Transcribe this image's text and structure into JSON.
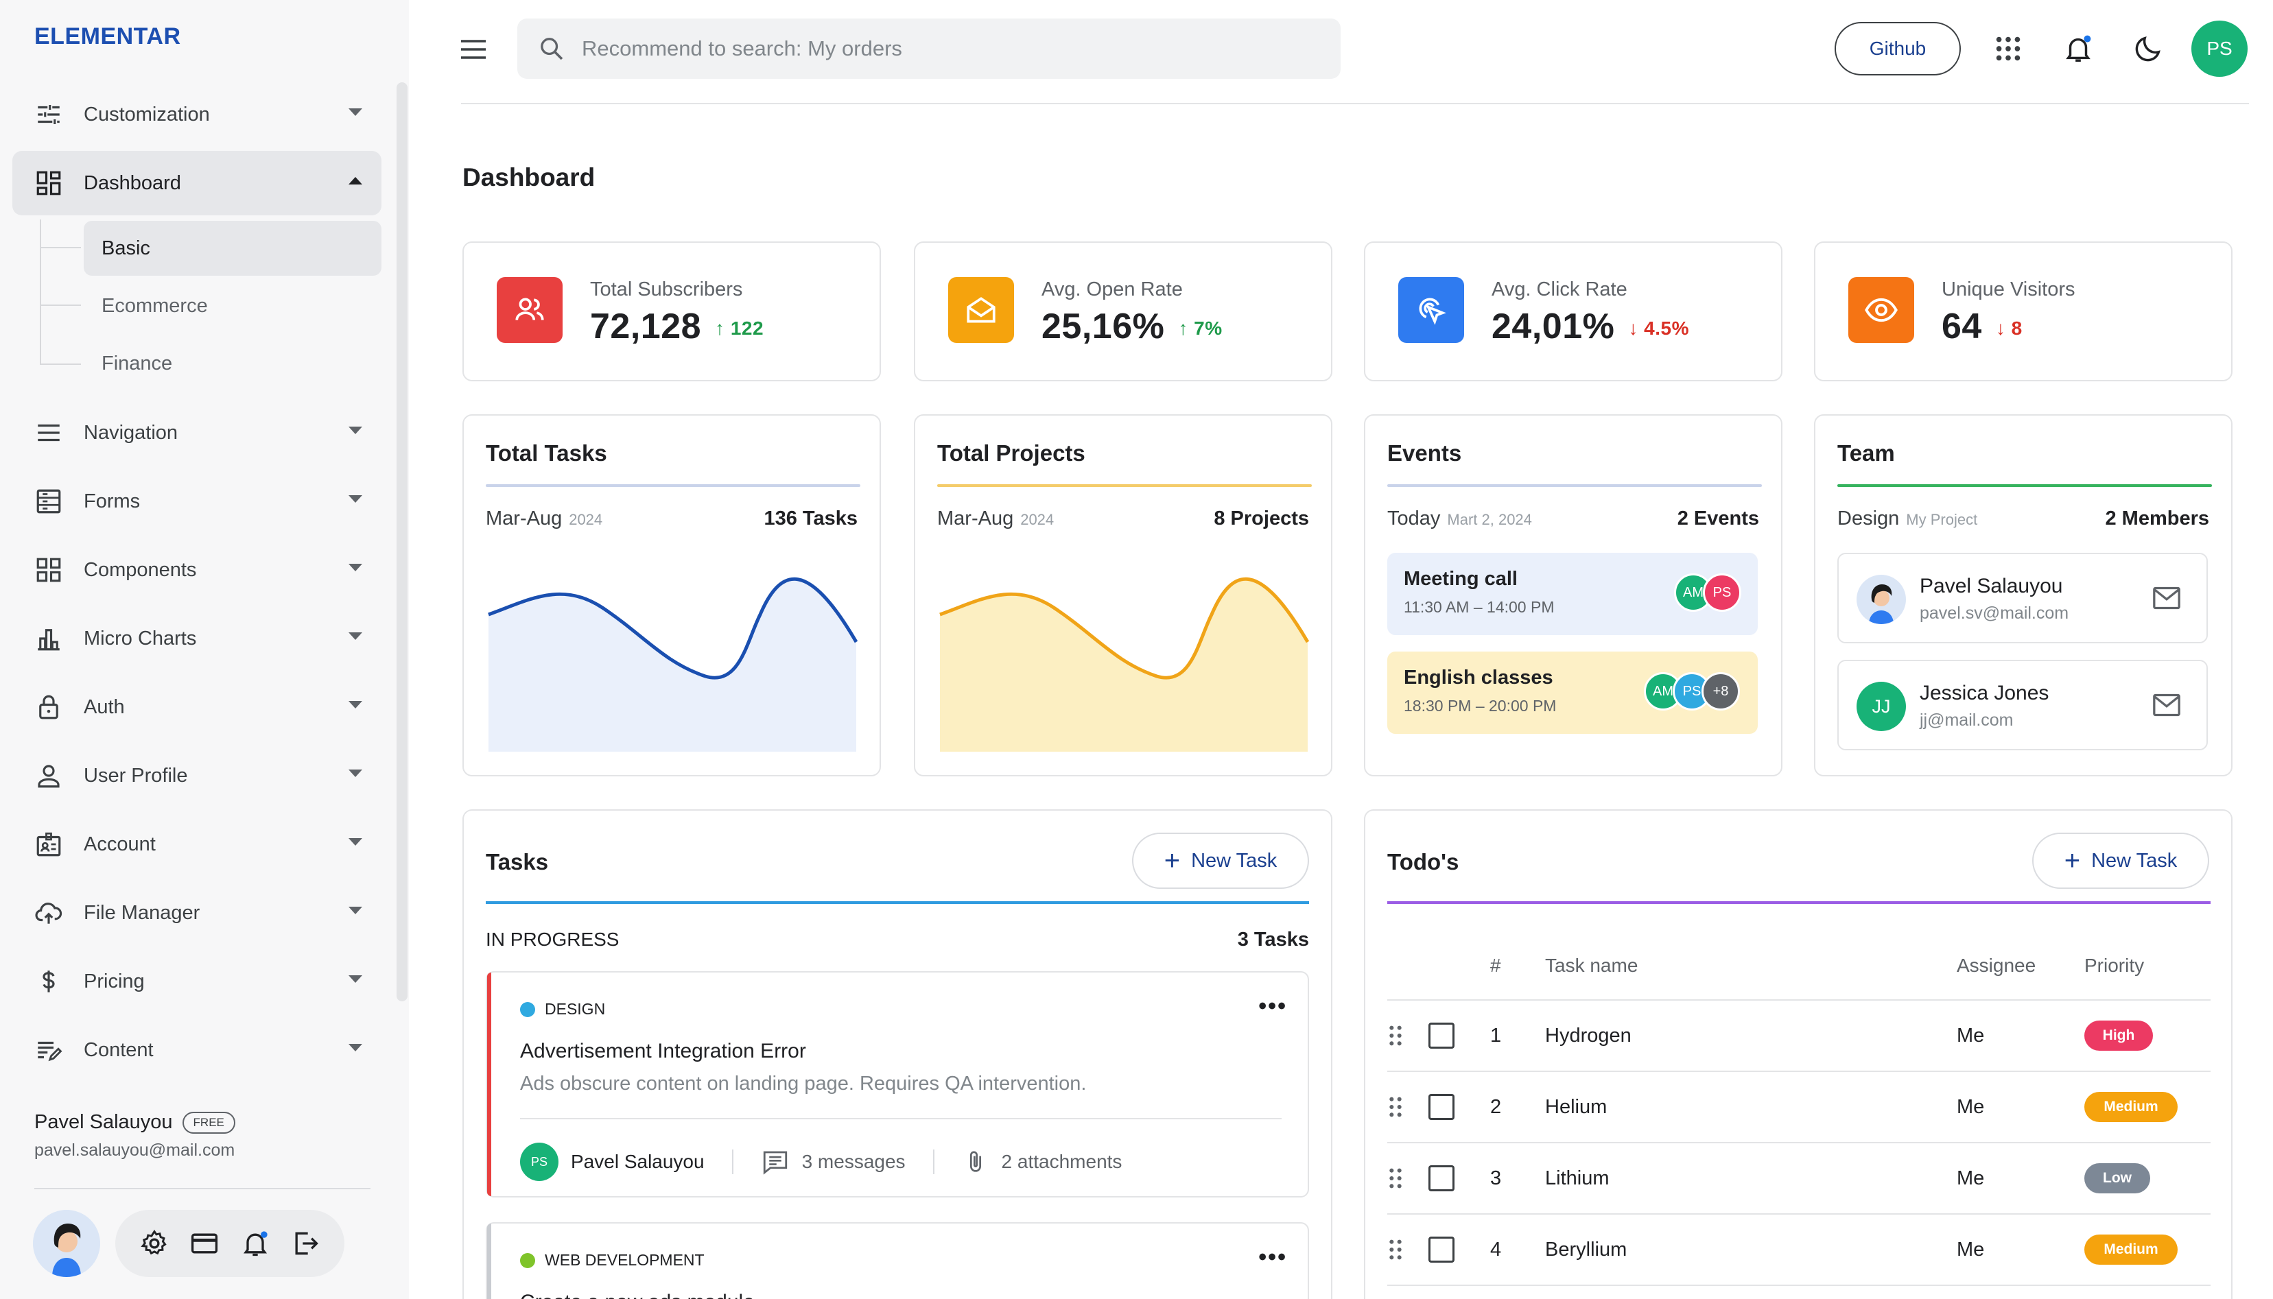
{
  "app": {
    "logo": "ELEMENTAR"
  },
  "sidebar": {
    "items": [
      {
        "label": "Customization",
        "icon": "sliders-icon"
      },
      {
        "label": "Dashboard",
        "icon": "dashboard-icon"
      },
      {
        "label": "Navigation",
        "icon": "menu-icon"
      },
      {
        "label": "Forms",
        "icon": "forms-icon"
      },
      {
        "label": "Components",
        "icon": "grid-icon"
      },
      {
        "label": "Micro Charts",
        "icon": "bar-chart-icon"
      },
      {
        "label": "Auth",
        "icon": "lock-icon"
      },
      {
        "label": "User Profile",
        "icon": "user-icon"
      },
      {
        "label": "Account",
        "icon": "id-card-icon"
      },
      {
        "label": "File Manager",
        "icon": "cloud-upload-icon"
      },
      {
        "label": "Pricing",
        "icon": "dollar-icon"
      },
      {
        "label": "Content",
        "icon": "edit-list-icon"
      }
    ],
    "dashboard_sub": [
      "Basic",
      "Ecommerce",
      "Finance"
    ],
    "user": {
      "name": "Pavel Salauyou",
      "badge": "FREE",
      "email": "pavel.salauyou@mail.com"
    }
  },
  "topbar": {
    "search_placeholder": "Recommend to search: My orders",
    "github_label": "Github",
    "avatar_initials": "PS"
  },
  "page": {
    "title": "Dashboard"
  },
  "stats": [
    {
      "label": "Total Subscribers",
      "value": "72,128",
      "delta": "122",
      "direction": "up",
      "color": "#e8403f",
      "icon": "users-icon"
    },
    {
      "label": "Avg. Open Rate",
      "value": "25,16%",
      "delta": "7%",
      "direction": "up",
      "color": "#f5a30d",
      "icon": "mail-open-icon"
    },
    {
      "label": "Avg. Click Rate",
      "value": "24,01%",
      "delta": "4.5%",
      "direction": "down",
      "color": "#2f7bf0",
      "icon": "click-icon"
    },
    {
      "label": "Unique Visitors",
      "value": "64",
      "delta": "8",
      "direction": "down",
      "color": "#f57414",
      "icon": "eye-icon"
    }
  ],
  "tasks_widget": {
    "title": "Total Tasks",
    "period": "Mar-Aug",
    "year": "2024",
    "total": "136 Tasks"
  },
  "projects_widget": {
    "title": "Total Projects",
    "period": "Mar-Aug",
    "year": "2024",
    "total": "8 Projects"
  },
  "events_widget": {
    "title": "Events",
    "period": "Today",
    "date": "Mart 2, 2024",
    "total": "2 Events",
    "events": [
      {
        "title": "Meeting call",
        "time": "11:30 AM – 14:00 PM",
        "avatars": [
          "AM",
          "PS"
        ]
      },
      {
        "title": "English classes",
        "time": "18:30 PM – 20:00 PM",
        "avatars": [
          "AM",
          "PS",
          "+8"
        ]
      }
    ]
  },
  "team_widget": {
    "title": "Team",
    "group": "Design",
    "project": "My Project",
    "total": "2 Members",
    "members": [
      {
        "name": "Pavel Salauyou",
        "email": "pavel.sv@mail.com",
        "initials": ""
      },
      {
        "name": "Jessica Jones",
        "email": "jj@mail.com",
        "initials": "JJ"
      }
    ]
  },
  "tasks": {
    "title": "Tasks",
    "new_label": "New Task",
    "status": "IN PROGRESS",
    "count": "3 Tasks",
    "items": [
      {
        "category": "DESIGN",
        "title": "Advertisement Integration Error",
        "desc": "Ads obscure content on landing page. Requires QA intervention.",
        "assignee_initials": "PS",
        "assignee": "Pavel Salauyou",
        "messages": "3 messages",
        "attachments": "2 attachments"
      },
      {
        "category": "WEB DEVELOPMENT",
        "title": "Create a new ads module"
      }
    ]
  },
  "todos": {
    "title": "Todo's",
    "new_label": "New Task",
    "headers": [
      "#",
      "Task name",
      "Assignee",
      "Priority"
    ],
    "rows": [
      {
        "n": "1",
        "name": "Hydrogen",
        "assignee": "Me",
        "priority": "High",
        "color": "#ec3a63"
      },
      {
        "n": "2",
        "name": "Helium",
        "assignee": "Me",
        "priority": "Medium",
        "color": "#f5a30d"
      },
      {
        "n": "3",
        "name": "Lithium",
        "assignee": "Me",
        "priority": "Low",
        "color": "#7d8896"
      },
      {
        "n": "4",
        "name": "Beryllium",
        "assignee": "Me",
        "priority": "Medium",
        "color": "#f5a30d"
      }
    ]
  }
}
